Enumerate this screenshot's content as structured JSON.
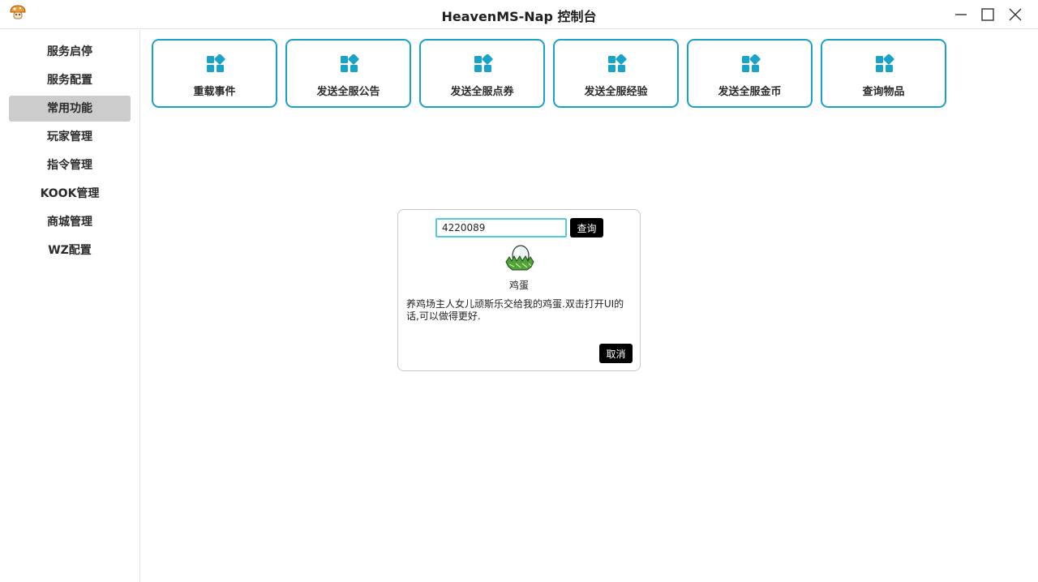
{
  "window": {
    "title": "HeavenMS-Nap 控制台",
    "app_icon": "mushroom-icon"
  },
  "sidebar": {
    "active_index": 2,
    "items": [
      {
        "label": "服务启停"
      },
      {
        "label": "服务配置"
      },
      {
        "label": "常用功能"
      },
      {
        "label": "玩家管理"
      },
      {
        "label": "指令管理"
      },
      {
        "label": "KOOK管理"
      },
      {
        "label": "商城管理"
      },
      {
        "label": "WZ配置"
      }
    ]
  },
  "actions": {
    "icon": "widgets-icon",
    "accent": "#1aa3c9",
    "items": [
      {
        "label": "重载事件"
      },
      {
        "label": "发送全服公告"
      },
      {
        "label": "发送全服点券"
      },
      {
        "label": "发送全服经验"
      },
      {
        "label": "发送全服金币"
      },
      {
        "label": "查询物品"
      }
    ]
  },
  "query_dialog": {
    "input_value": "4220089",
    "query_label": "查询",
    "item_icon": "egg-in-nest-icon",
    "item_name": "鸡蛋",
    "item_desc": "养鸡场主人女儿顽斯乐交给我的鸡蛋.双击打开UI的话,可以做得更好.",
    "cancel_label": "取消"
  }
}
